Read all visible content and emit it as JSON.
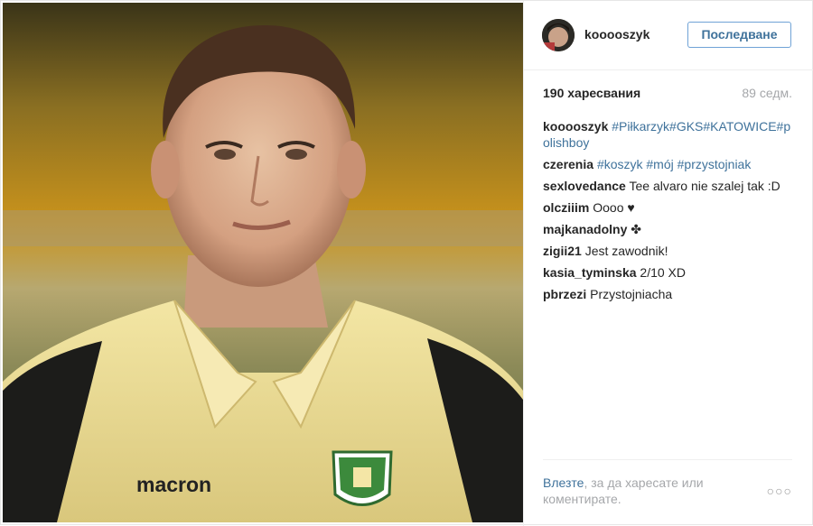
{
  "header": {
    "username": "kooooszyk",
    "follow_label": "Последване"
  },
  "stats": {
    "likes": "190 харесвания",
    "age": "89 седм."
  },
  "comments": [
    {
      "author": "kooooszyk",
      "text": "#Piłkarzyk#GKS#KATOWICE#polishboy"
    },
    {
      "author": "czerenia",
      "text": "#koszyk #mój #przystojniak"
    },
    {
      "author": "sexlovedance",
      "text": "Tee alvaro nie szalej tak :D"
    },
    {
      "author": "olcziiim",
      "text": "Oooo ♥"
    },
    {
      "author": "majkanadolny",
      "text": "✤"
    },
    {
      "author": "zigii21",
      "text": "Jest zawodnik!"
    },
    {
      "author": "kasia_tyminska",
      "text": "2/10 XD"
    },
    {
      "author": "pbrzezi",
      "text": "Przystojniacha"
    }
  ],
  "footer": {
    "login_link": "Влезте",
    "login_rest": ", за да харесате или коментирате.",
    "more_label": "○○○"
  },
  "photo": {
    "jersey_brand": "macron"
  }
}
